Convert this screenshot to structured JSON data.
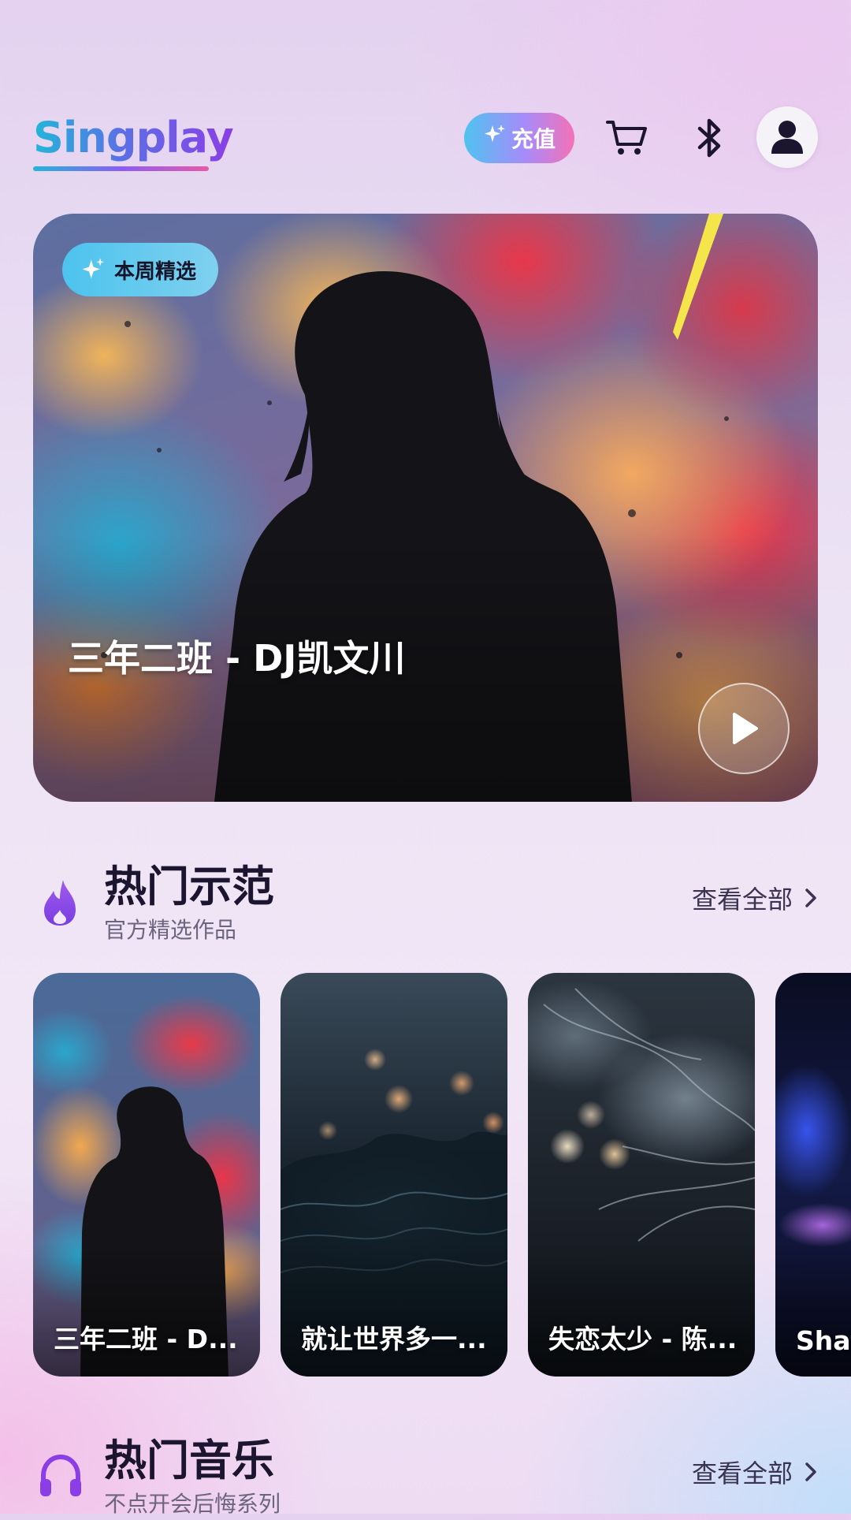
{
  "app": {
    "logo": "Singplay"
  },
  "header": {
    "recharge_label": "充值",
    "icons": [
      "sparkle-icon",
      "cart-icon",
      "bluetooth-icon",
      "user-icon"
    ]
  },
  "hero": {
    "badge": "本周精选",
    "title": "三年二班 - DJ凯文川"
  },
  "hot_demo": {
    "title": "热门示范",
    "subtitle": "官方精选作品",
    "see_all": "查看全部",
    "cards": [
      {
        "title": "三年二班 - D..."
      },
      {
        "title": "就让世界多一..."
      },
      {
        "title": "失恋太少 - 陈..."
      },
      {
        "title": "Shat"
      }
    ]
  },
  "hot_music": {
    "title": "热门音乐",
    "subtitle": "不点开会后悔系列",
    "see_all": "查看全部"
  },
  "colors": {
    "accent_purple": "#8b3ee6",
    "accent_cyan": "#22b6d8",
    "accent_pink": "#f472b6"
  }
}
